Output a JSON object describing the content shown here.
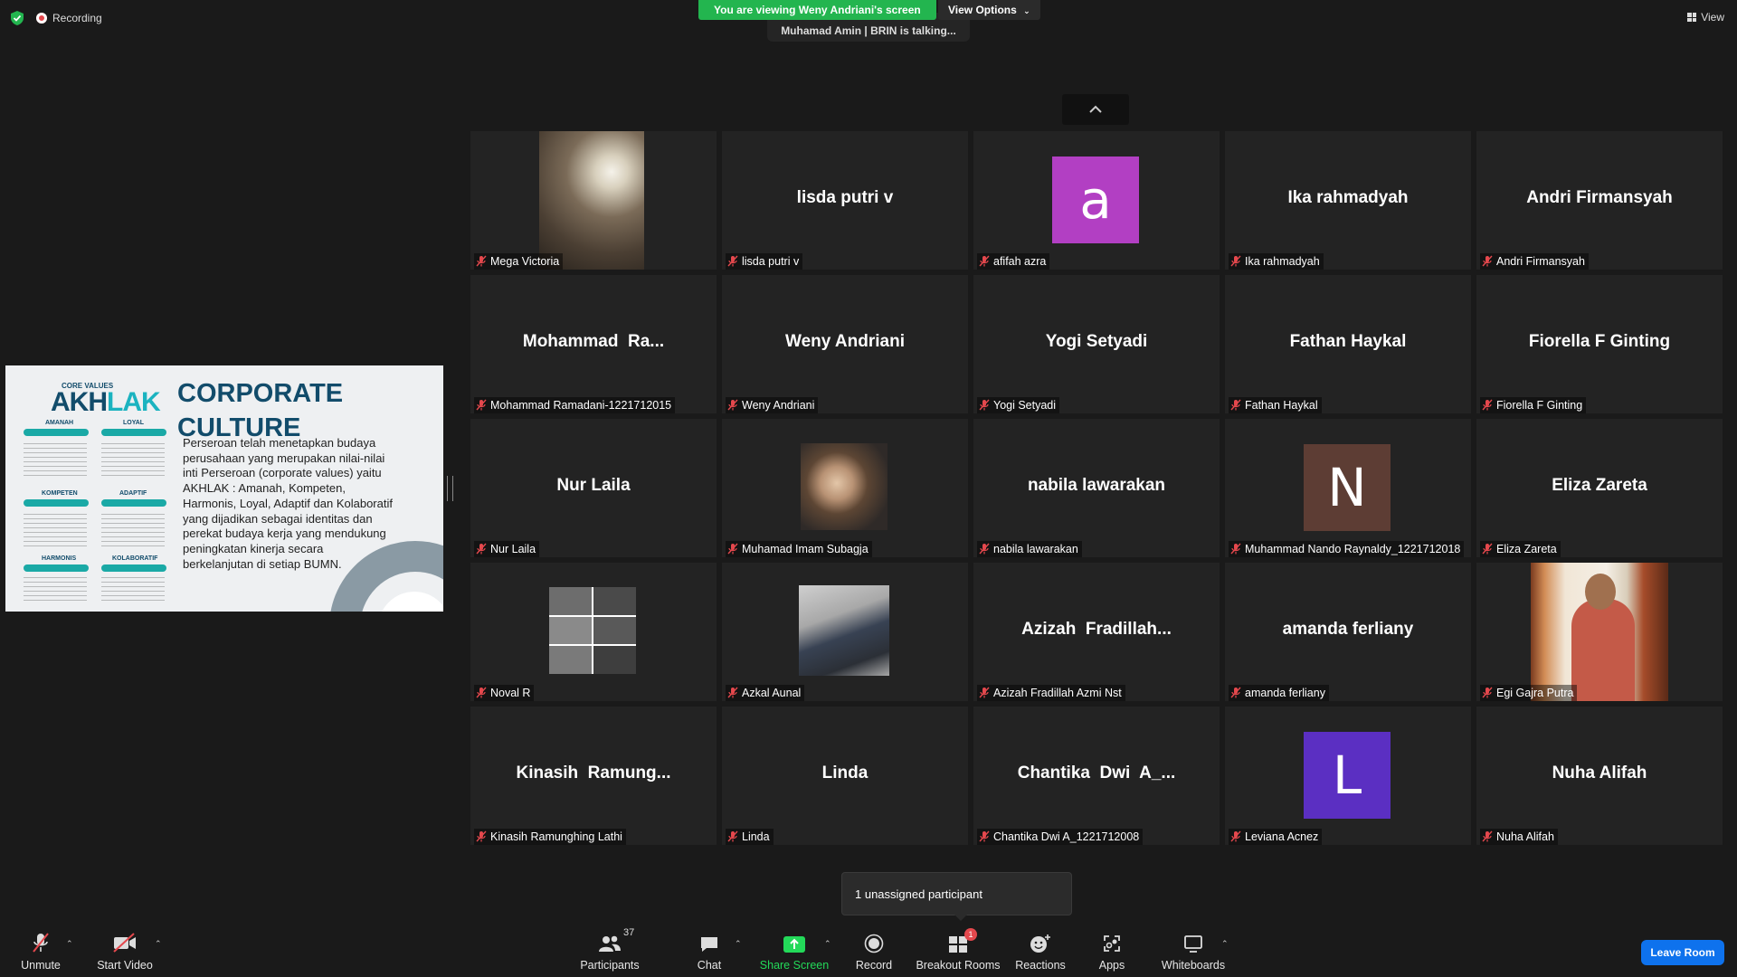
{
  "top": {
    "recording_label": "Recording",
    "viewing_banner": "You are viewing Weny Andriani's screen",
    "view_options": "View Options",
    "talking": "Muhamad Amin | BRIN is talking...",
    "view_label": "View"
  },
  "slide": {
    "core_values": "CORE VALUES",
    "brand_a": "AKH",
    "brand_b": "LAK",
    "values": [
      "AMANAH",
      "LOYAL",
      "KOMPETEN",
      "ADAPTIF",
      "HARMONIS",
      "KOLABORATIF"
    ],
    "title_line1": "CORPORATE",
    "title_line2": "CULTURE",
    "body": "Perseroan telah menetapkan budaya perusahaan yang merupakan nilai-nilai inti Perseroan (corporate values) yaitu AKHLAK : Amanah, Kompeten, Harmonis, Loyal, Adaptif dan Kolaboratif yang dijadikan sebagai identitas dan perekat budaya kerja yang mendukung peningkatan kinerja secara berkelanjutan di setiap BUMN."
  },
  "tiles": [
    {
      "label": "Mega Victoria",
      "display": ""
    },
    {
      "label": "lisda putri v",
      "display": "lisda putri v"
    },
    {
      "label": "afifah azra",
      "display": "",
      "avatar": "a",
      "avatar_color": "#b23fc3"
    },
    {
      "label": "Ika rahmadyah",
      "display": "Ika rahmadyah"
    },
    {
      "label": "Andri Firmansyah",
      "display": "Andri Firmansyah"
    },
    {
      "label": "Mohammad Ramadani-1221712015",
      "display": "Mohammad  Ra..."
    },
    {
      "label": "Weny Andriani",
      "display": "Weny Andriani"
    },
    {
      "label": "Yogi Setyadi",
      "display": "Yogi Setyadi"
    },
    {
      "label": "Fathan Haykal",
      "display": "Fathan Haykal"
    },
    {
      "label": "Fiorella F Ginting",
      "display": "Fiorella F Ginting"
    },
    {
      "label": "Nur Laila",
      "display": "Nur Laila"
    },
    {
      "label": "Muhamad Imam Subagja",
      "display": ""
    },
    {
      "label": "nabila lawarakan",
      "display": "nabila lawarakan"
    },
    {
      "label": "Muhammad Nando Raynaldy_1221712018",
      "display": "",
      "avatar": "N",
      "avatar_color": "#5d3d34"
    },
    {
      "label": "Eliza Zareta",
      "display": "Eliza Zareta"
    },
    {
      "label": "Noval R",
      "display": ""
    },
    {
      "label": "Azkal Aunal",
      "display": ""
    },
    {
      "label": "Azizah Fradillah Azmi Nst",
      "display": "Azizah  Fradillah..."
    },
    {
      "label": "amanda ferliany",
      "display": "amanda ferliany"
    },
    {
      "label": "Egi Gajra Putra",
      "display": ""
    },
    {
      "label": "Kinasih Ramunghing Lathi",
      "display": "Kinasih  Ramung..."
    },
    {
      "label": "Linda",
      "display": "Linda"
    },
    {
      "label": "Chantika Dwi A_1221712008",
      "display": "Chantika  Dwi  A_..."
    },
    {
      "label": "Leviana Acnez",
      "display": "",
      "avatar": "L",
      "avatar_color": "#5b2fc2"
    },
    {
      "label": "Nuha Alifah",
      "display": "Nuha Alifah"
    }
  ],
  "tooltip": "1 unassigned participant",
  "toolbar": {
    "unmute": "Unmute",
    "start_video": "Start Video",
    "participants": "Participants",
    "participants_count": "37",
    "chat": "Chat",
    "share_screen": "Share Screen",
    "record": "Record",
    "breakout_rooms": "Breakout Rooms",
    "breakout_badge": "1",
    "reactions": "Reactions",
    "apps": "Apps",
    "whiteboards": "Whiteboards",
    "leave_room": "Leave Room"
  },
  "colors": {
    "banner_green": "#23b54f",
    "share_green": "#23d959",
    "leave_blue": "#0e72ed",
    "mic_red": "#e5484d"
  }
}
